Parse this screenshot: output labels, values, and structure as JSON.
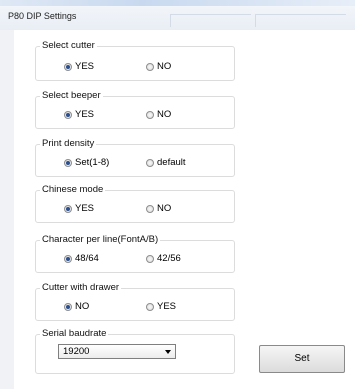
{
  "window": {
    "title": "P80 DIP Settings"
  },
  "groups": [
    {
      "legend": "Select cutter",
      "options": [
        {
          "label": "YES",
          "checked": true
        },
        {
          "label": "NO",
          "checked": false
        }
      ]
    },
    {
      "legend": "Select beeper",
      "options": [
        {
          "label": "YES",
          "checked": true
        },
        {
          "label": "NO",
          "checked": false
        }
      ]
    },
    {
      "legend": "Print density",
      "options": [
        {
          "label": "Set(1-8)",
          "checked": true
        },
        {
          "label": "default",
          "checked": false
        }
      ]
    },
    {
      "legend": "Chinese mode",
      "options": [
        {
          "label": "YES",
          "checked": true
        },
        {
          "label": "NO",
          "checked": false
        }
      ]
    },
    {
      "legend": "Character per line(FontA/B)",
      "options": [
        {
          "label": "48/64",
          "checked": true
        },
        {
          "label": "42/56",
          "checked": false
        }
      ]
    },
    {
      "legend": "Cutter with drawer",
      "options": [
        {
          "label": "NO",
          "checked": true
        },
        {
          "label": "YES",
          "checked": false
        }
      ]
    }
  ],
  "baudrate": {
    "legend": "Serial baudrate",
    "value": "19200"
  },
  "buttons": {
    "set_label": "Set"
  }
}
